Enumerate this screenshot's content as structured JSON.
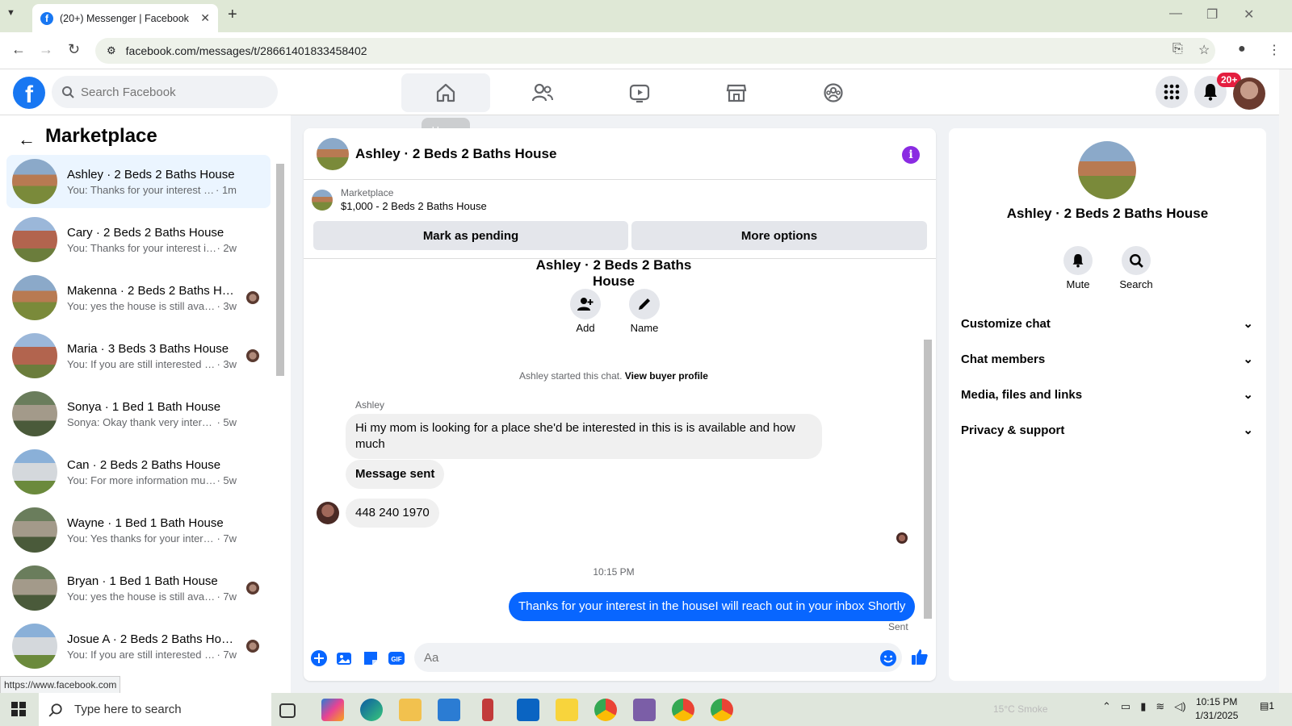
{
  "browser": {
    "tab_title": "(20+) Messenger | Facebook",
    "url": "facebook.com/messages/t/28661401833458402",
    "status_url": "https://www.facebook.com"
  },
  "fb_header": {
    "search_placeholder": "Search Facebook",
    "tooltip": "Home",
    "notifications_badge": "20+"
  },
  "sidebar": {
    "title": "Marketplace",
    "conversations": [
      {
        "name": "Ashley · 2 Beds 2 Baths House",
        "preview": "You: Thanks for your interest in th...",
        "time": "· 1m",
        "selected": true
      },
      {
        "name": "Cary · 2 Beds 2 Baths House",
        "preview": "You: Thanks for your interest in the...",
        "time": "· 2w"
      },
      {
        "name": "Makenna · 2 Beds 2 Baths Ho...",
        "preview": "You: yes the house is still availa...",
        "time": "· 3w"
      },
      {
        "name": "Maria · 3 Beds 3 Baths House",
        "preview": "You: If you are still interested se...",
        "time": "· 3w"
      },
      {
        "name": "Sonya · 1 Bed 1 Bath House",
        "preview": "Sonya: Okay thank very interested....",
        "time": "· 5w"
      },
      {
        "name": "Can · 2 Beds 2 Baths House",
        "preview": "You: For more information must se...",
        "time": "· 5w"
      },
      {
        "name": "Wayne · 1 Bed 1 Bath House",
        "preview": "You: Yes thanks for your interest fo...",
        "time": "· 7w"
      },
      {
        "name": "Bryan · 1 Bed 1 Bath House",
        "preview": "You: yes the house is still availa...",
        "time": "· 7w"
      },
      {
        "name": "Josue A · 2 Beds 2 Baths House",
        "preview": "You: If you are still interested se...",
        "time": "· 7w"
      }
    ]
  },
  "chat": {
    "title": "Ashley · 2 Beds 2 Baths House",
    "marketplace_label": "Marketplace",
    "listing": "$1,000 - 2 Beds 2 Baths House",
    "mark_pending": "Mark as pending",
    "more_options": "More options",
    "intro_name": "Ashley · 2 Beds 2 Baths House",
    "add_label": "Add",
    "name_label": "Name",
    "started_text": "Ashley started this chat.",
    "view_profile": "View buyer profile",
    "sender": "Ashley",
    "msg1": "Hi my mom is looking for a place she'd be interested in this is is available and how much",
    "msg2": "Message sent",
    "msg3": "448 240 1970",
    "timestamp": "10:15 PM",
    "outgoing": "Thanks for your interest in the houseI will reach out in your inbox Shortly",
    "sent_status": "Sent",
    "composer_placeholder": "Aa"
  },
  "right_panel": {
    "name": "Ashley · 2 Beds 2 Baths House",
    "mute": "Mute",
    "search": "Search",
    "sections": [
      "Customize chat",
      "Chat members",
      "Media, files and links",
      "Privacy & support"
    ]
  },
  "taskbar": {
    "search_placeholder": "Type here to search",
    "weather": "15°C  Smoke",
    "time": "10:15 PM",
    "date": "1/31/2025",
    "notif_count": "1"
  },
  "colors": {
    "fb_blue": "#1877f2",
    "messenger_blue": "#0866ff",
    "info_purple": "#8a2be2",
    "badge_red": "#e41e3f"
  }
}
